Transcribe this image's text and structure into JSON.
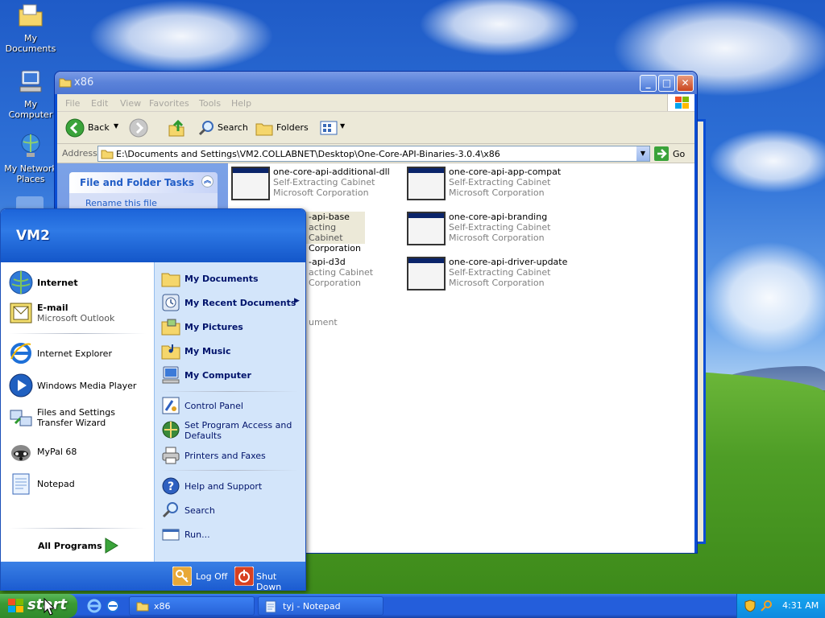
{
  "desktop": {
    "icons": [
      {
        "label": "My Documents"
      },
      {
        "label": "My Computer"
      },
      {
        "label": "My Network Places"
      }
    ]
  },
  "explorer": {
    "title": "x86",
    "menu": [
      "File",
      "Edit",
      "View",
      "Favorites",
      "Tools",
      "Help"
    ],
    "toolbar": {
      "back": "Back",
      "search": "Search",
      "folders": "Folders"
    },
    "address_label": "Address",
    "address_value": "E:\\Documents and Settings\\VM2.COLLABNET\\Desktop\\One-Core-API-Binaries-3.0.4\\x86",
    "go_label": "Go",
    "task_panel": {
      "title": "File and Folder Tasks",
      "item": "Rename this file"
    },
    "files": [
      {
        "name": "one-core-api-additional-dll",
        "type": "Self-Extracting Cabinet",
        "company": "Microsoft Corporation"
      },
      {
        "name": "one-core-api-app-compat",
        "type": "Self-Extracting Cabinet",
        "company": "Microsoft Corporation"
      },
      {
        "name": "-api-base",
        "type": "acting Cabinet",
        "company": "Corporation"
      },
      {
        "name": "one-core-api-branding",
        "type": "Self-Extracting Cabinet",
        "company": "Microsoft Corporation"
      },
      {
        "name": "-api-d3d",
        "type": "acting Cabinet",
        "company": "Corporation"
      },
      {
        "name": "one-core-api-driver-update",
        "type": "Self-Extracting Cabinet",
        "company": "Microsoft Corporation"
      }
    ],
    "partial_item": "ument"
  },
  "start_menu": {
    "user": "VM2",
    "pinned": [
      {
        "label": "Internet"
      },
      {
        "label": "E-mail",
        "sub": "Microsoft Outlook"
      }
    ],
    "recent": [
      {
        "label": "Internet Explorer"
      },
      {
        "label": "Windows Media Player"
      },
      {
        "label": "Files and Settings Transfer Wizard"
      },
      {
        "label": "MyPal 68"
      },
      {
        "label": "Notepad"
      }
    ],
    "all_programs": "All Programs",
    "right": [
      {
        "label": "My Documents"
      },
      {
        "label": "My Recent Documents"
      },
      {
        "label": "My Pictures"
      },
      {
        "label": "My Music"
      },
      {
        "label": "My Computer"
      },
      {
        "label": "Control Panel"
      },
      {
        "label": "Set Program Access and Defaults"
      },
      {
        "label": "Printers and Faxes"
      },
      {
        "label": "Help and Support"
      },
      {
        "label": "Search"
      },
      {
        "label": "Run..."
      }
    ],
    "log_off": "Log Off",
    "shut_down": "Shut Down"
  },
  "taskbar": {
    "start": "start",
    "items": [
      {
        "label": "x86"
      },
      {
        "label": "tyj - Notepad"
      }
    ],
    "clock": "4:31 AM"
  }
}
